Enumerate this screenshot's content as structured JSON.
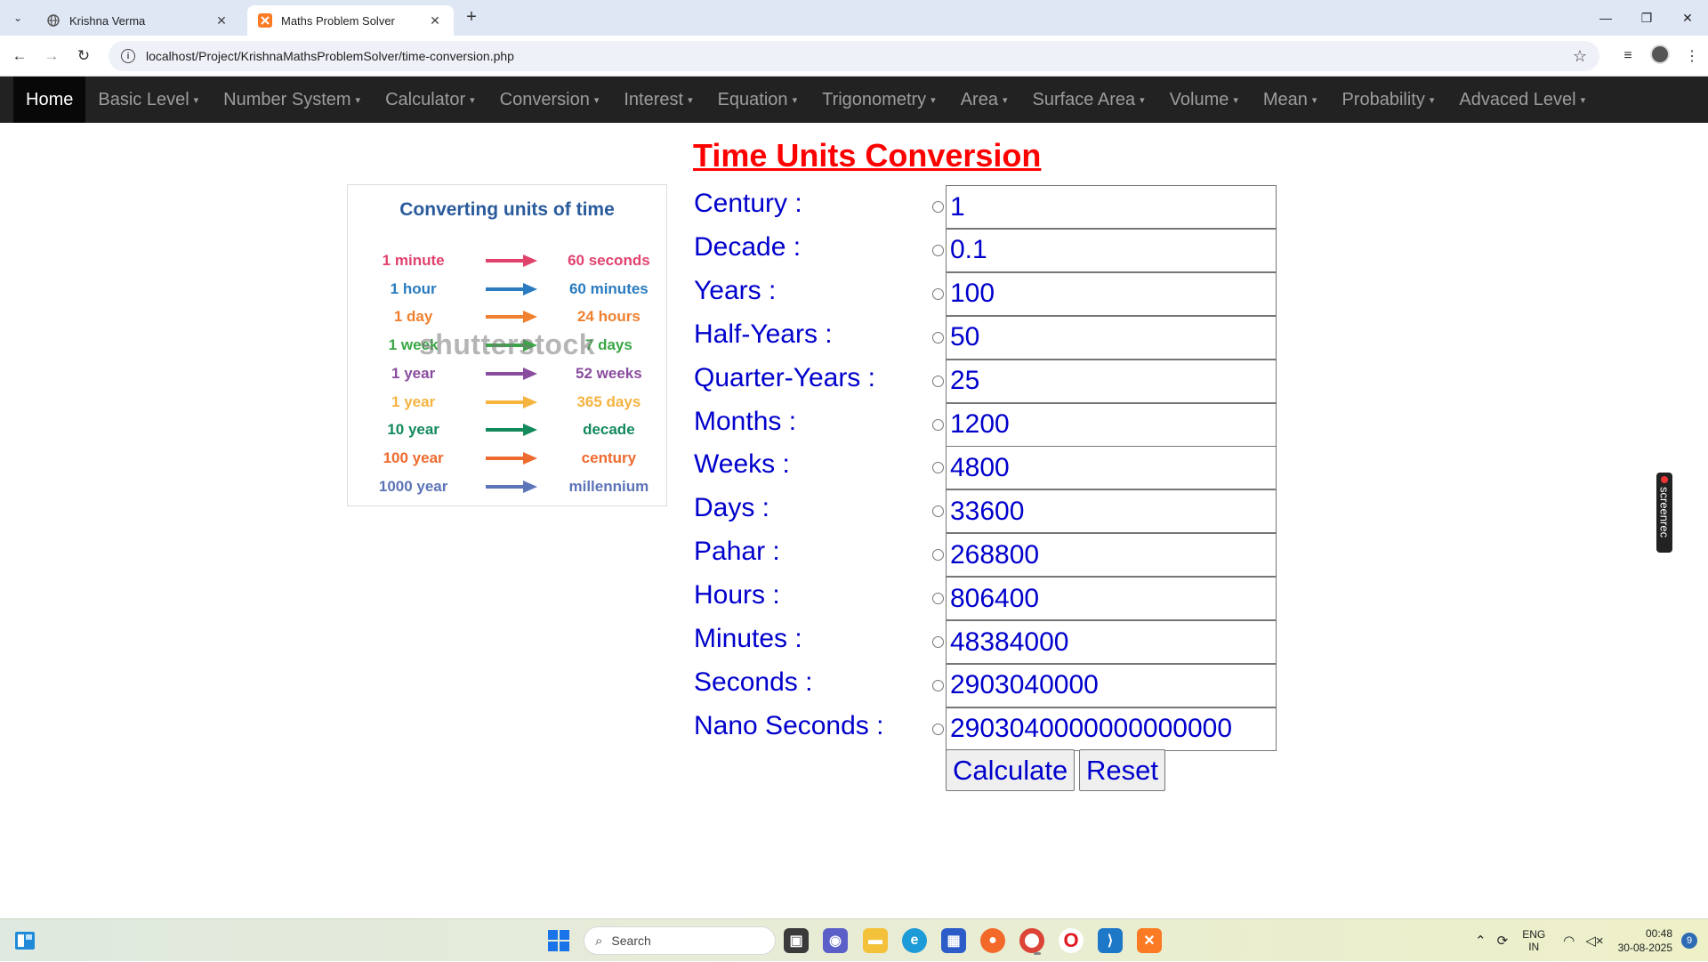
{
  "browser": {
    "tabs": [
      {
        "title": "Krishna Verma",
        "active": false
      },
      {
        "title": "Maths Problem Solver",
        "active": true
      }
    ],
    "url": "localhost/Project/KrishnaMathsProblemSolver/time-conversion.php"
  },
  "navbar": {
    "items": [
      {
        "label": "Home",
        "dropdown": false,
        "active": true
      },
      {
        "label": "Basic Level",
        "dropdown": true
      },
      {
        "label": "Number System",
        "dropdown": true
      },
      {
        "label": "Calculator",
        "dropdown": true
      },
      {
        "label": "Conversion",
        "dropdown": true
      },
      {
        "label": "Interest",
        "dropdown": true
      },
      {
        "label": "Equation",
        "dropdown": true
      },
      {
        "label": "Trigonometry",
        "dropdown": true
      },
      {
        "label": "Area",
        "dropdown": true
      },
      {
        "label": "Surface Area",
        "dropdown": true
      },
      {
        "label": "Volume",
        "dropdown": true
      },
      {
        "label": "Mean",
        "dropdown": true
      },
      {
        "label": "Probability",
        "dropdown": true
      },
      {
        "label": "Advaced Level",
        "dropdown": true
      }
    ]
  },
  "page": {
    "title": "Time Units Conversion"
  },
  "info_card": {
    "title": "Converting units of time",
    "watermark": "shutterstock",
    "rows": [
      {
        "from": "1 minute",
        "to": "60 seconds",
        "color": "#e0426c"
      },
      {
        "from": "1 hour",
        "to": "60 minutes",
        "color": "#2a7bbf"
      },
      {
        "from": "1 day",
        "to": "24 hours",
        "color": "#ef8030"
      },
      {
        "from": "1 week",
        "to": "7 days",
        "color": "#3aa646"
      },
      {
        "from": "1 year",
        "to": "52 weeks",
        "color": "#8a4c9e"
      },
      {
        "from": "1 year",
        "to": "365 days",
        "color": "#f5b340"
      },
      {
        "from": "10 year",
        "to": "decade",
        "color": "#138a5c"
      },
      {
        "from": "100 year",
        "to": "century",
        "color": "#ee6a2e"
      },
      {
        "from": "1000 year",
        "to": "millennium",
        "color": "#5c74b8"
      }
    ]
  },
  "form": {
    "fields": [
      {
        "label": "Century :",
        "value": "1"
      },
      {
        "label": "Decade :",
        "value": "0.1"
      },
      {
        "label": "Years :",
        "value": "100"
      },
      {
        "label": "Half-Years :",
        "value": "50"
      },
      {
        "label": "Quarter-Years :",
        "value": "25"
      },
      {
        "label": "Months :",
        "value": "1200"
      },
      {
        "label": "Weeks :",
        "value": "4800"
      },
      {
        "label": "Days :",
        "value": "33600"
      },
      {
        "label": "Pahar :",
        "value": "268800"
      },
      {
        "label": "Hours :",
        "value": "806400"
      },
      {
        "label": "Minutes :",
        "value": "48384000"
      },
      {
        "label": "Seconds :",
        "value": "2903040000"
      },
      {
        "label": "Nano Seconds :",
        "value": "2903040000000000000"
      }
    ],
    "calculate_label": "Calculate",
    "reset_label": "Reset"
  },
  "overlay": {
    "screenrec_label": "screenrec"
  },
  "taskbar": {
    "search_placeholder": "Search",
    "language": "ENG",
    "region": "IN",
    "time": "00:48",
    "date": "30-08-2025",
    "notification_count": "9"
  }
}
